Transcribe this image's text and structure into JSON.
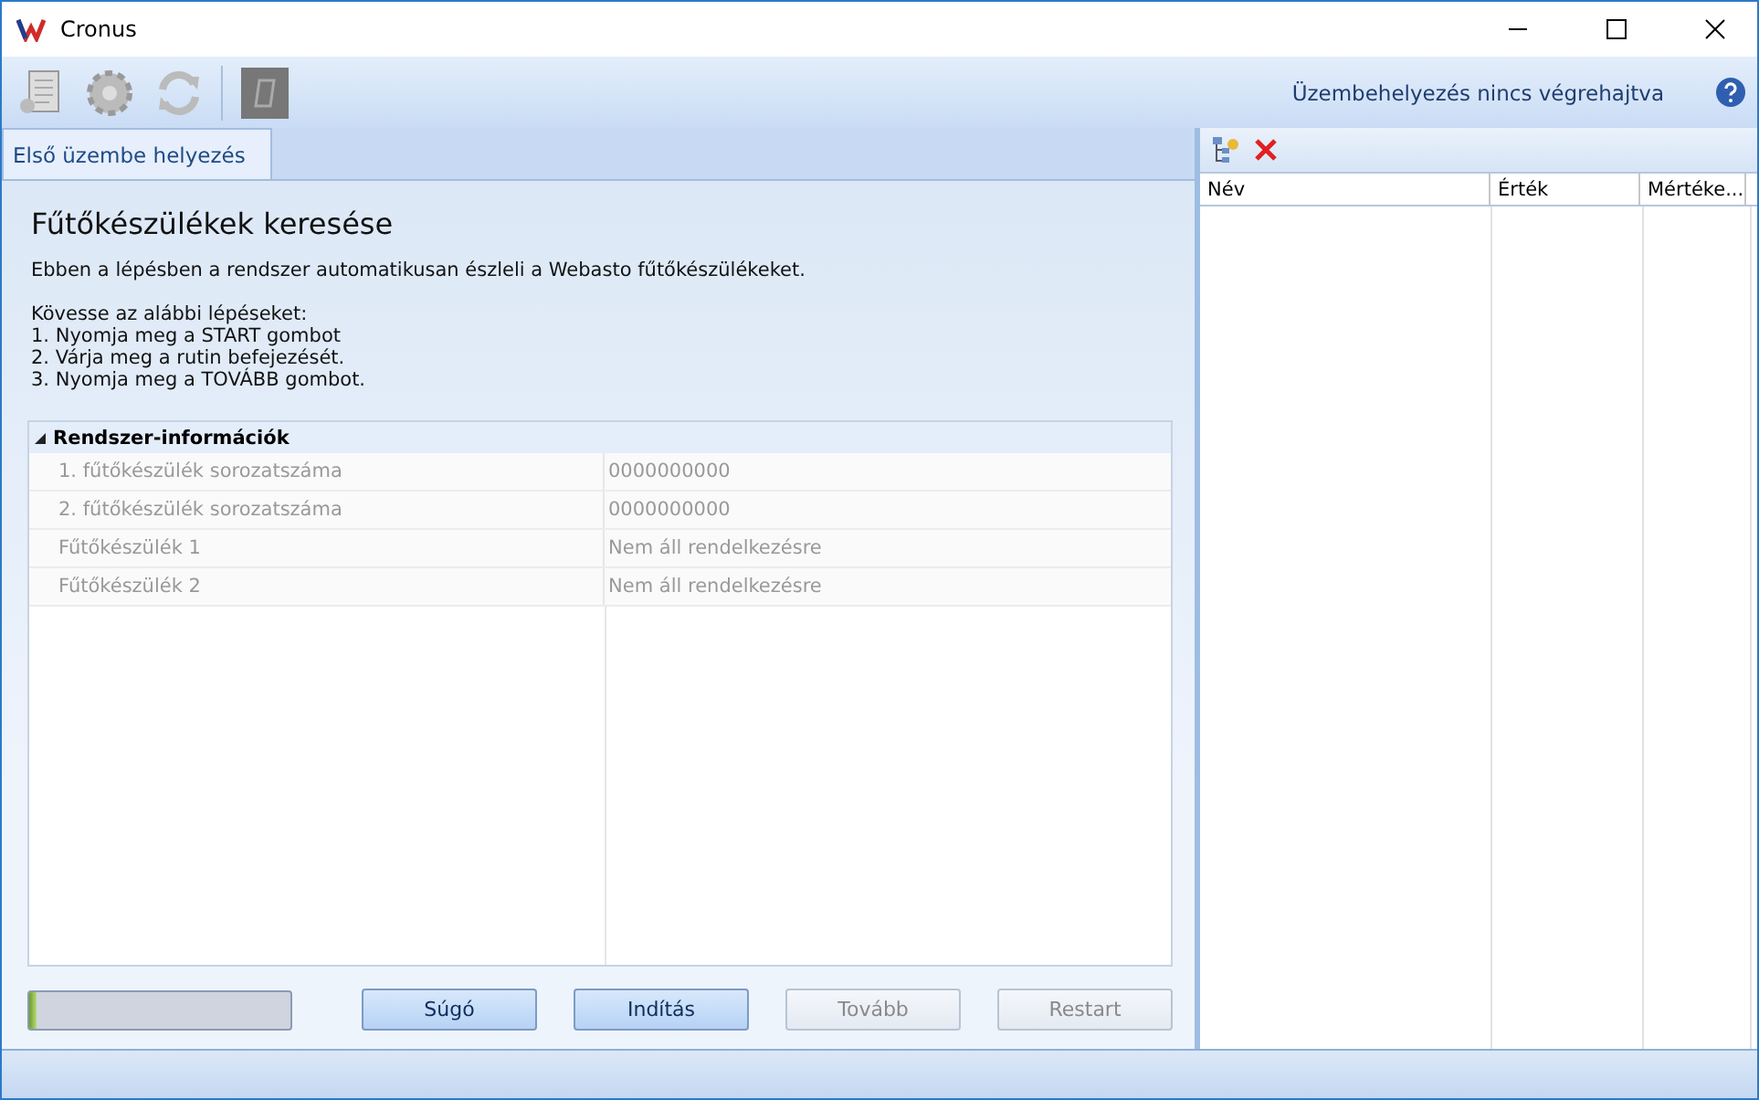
{
  "window": {
    "title": "Cronus"
  },
  "toolbar": {
    "status": "Üzembehelyezés nincs végrehajtva"
  },
  "tabs": [
    {
      "label": "Első üzembe helyezés",
      "selected": true
    }
  ],
  "page": {
    "heading": "Fűtőkészülékek keresése",
    "description": "Ebben a lépésben a rendszer automatikusan észleli a Webasto fűtőkészülékeket.",
    "instructions": [
      "Kövesse az alábbi lépéseket:",
      "1. Nyomja meg a START gombot",
      "2. Várja meg a rutin befejezését.",
      "3. Nyomja meg a TOVÁBB gombot."
    ]
  },
  "property_grid": {
    "category": "Rendszer-információk",
    "expanded": true,
    "rows": [
      {
        "name": "1. fűtőkészülék sorozatszáma",
        "value": "0000000000"
      },
      {
        "name": "2. fűtőkészülék sorozatszáma",
        "value": "0000000000"
      },
      {
        "name": "Fűtőkészülék 1",
        "value": "Nem áll rendelkezésre"
      },
      {
        "name": "Fűtőkészülék 2",
        "value": "Nem áll rendelkezésre"
      }
    ]
  },
  "progress": {
    "level": 0.03
  },
  "buttons": [
    {
      "label": "Súgó",
      "disabled": false
    },
    {
      "label": "Indítás",
      "disabled": false
    },
    {
      "label": "Tovább",
      "disabled": true
    },
    {
      "label": "Restart",
      "disabled": true
    }
  ],
  "side_table": {
    "columns": [
      "Név",
      "Érték",
      "Mértéke..."
    ]
  }
}
